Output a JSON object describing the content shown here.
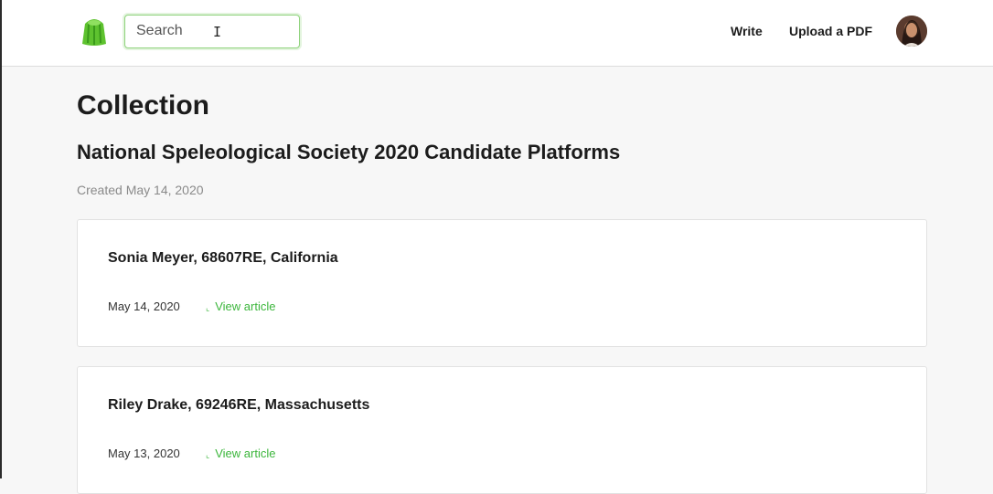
{
  "header": {
    "search": {
      "placeholder": "Search",
      "value": ""
    },
    "nav": {
      "write": "Write",
      "upload": "Upload a PDF"
    }
  },
  "page": {
    "heading": "Collection",
    "collection_title": "National Speleological Society 2020 Candidate Platforms",
    "created": "Created May 14, 2020"
  },
  "articles": [
    {
      "title": "Sonia Meyer, 68607RE, California",
      "date": "May 14, 2020",
      "link": "View article"
    },
    {
      "title": "Riley Drake, 69246RE, Massachusetts",
      "date": "May 13, 2020",
      "link": "View article"
    }
  ],
  "colors": {
    "accent": "#3cb63c",
    "logo": "#5ec22f",
    "focus_border": "#8fd27c"
  },
  "icons": {
    "logo": "jelly-logo-icon",
    "cursor": "text-cursor-icon",
    "avatar": "user-avatar"
  }
}
